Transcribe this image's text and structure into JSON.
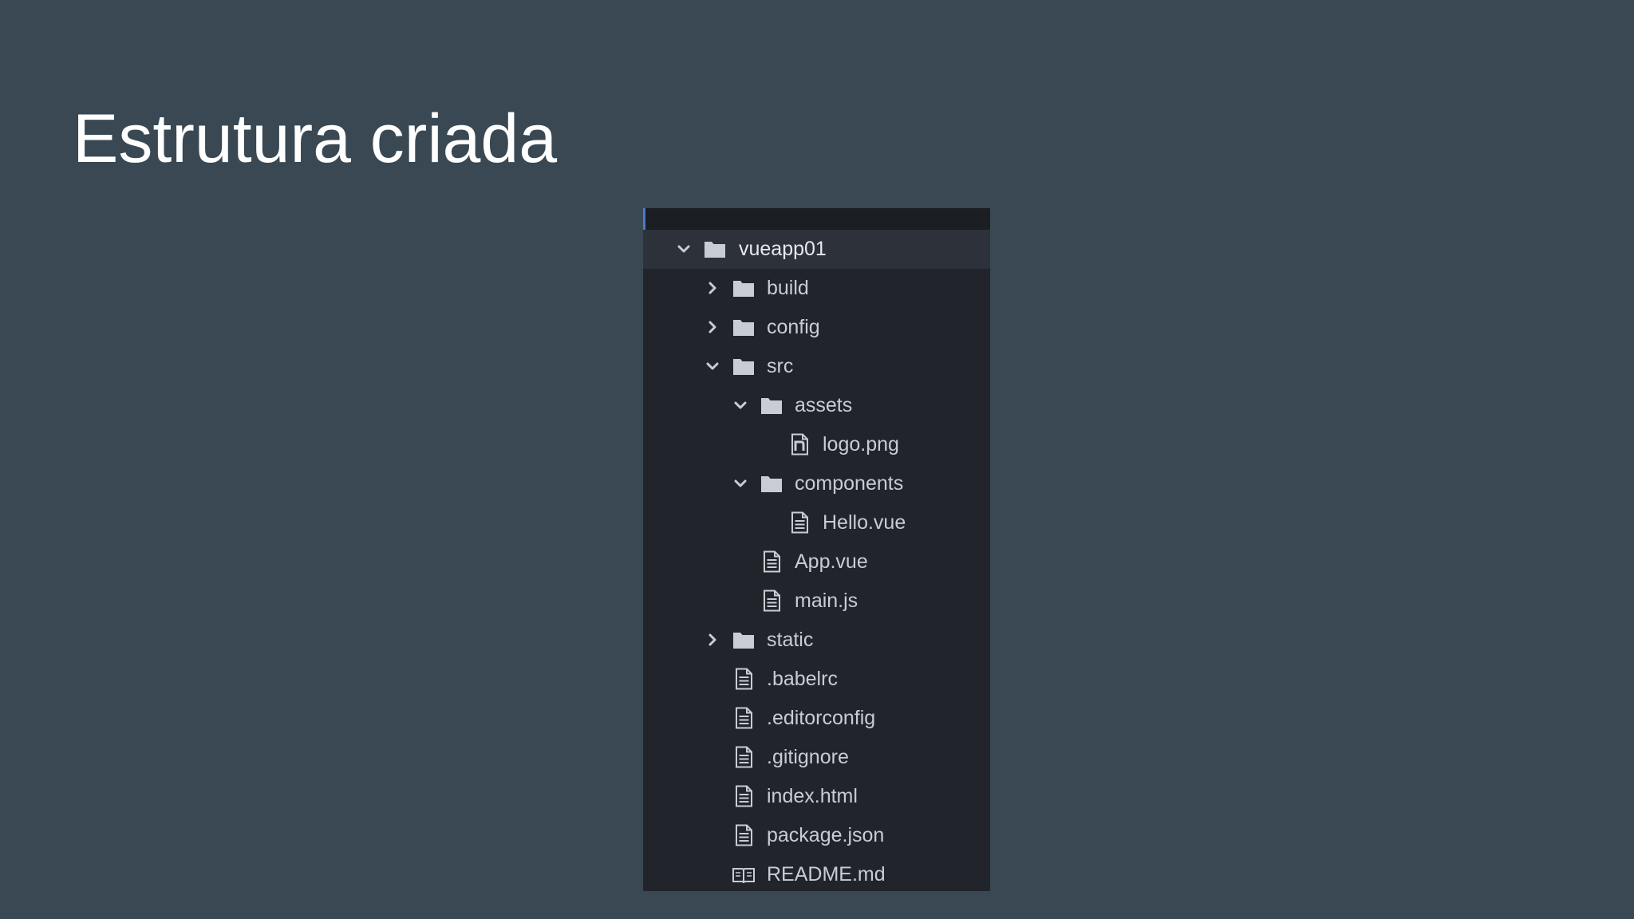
{
  "slide": {
    "title": "Estrutura criada"
  },
  "colors": {
    "background": "#394852",
    "panel": "#21252b",
    "selected_row": "#2c313a",
    "text": "#c8cdd4",
    "icon": "#c8cdd4"
  },
  "tree": {
    "root": {
      "label": "vueapp01",
      "icon": "folder-icon",
      "state": "expanded"
    },
    "build": {
      "label": "build",
      "icon": "folder-icon",
      "state": "collapsed"
    },
    "config": {
      "label": "config",
      "icon": "folder-icon",
      "state": "collapsed"
    },
    "src": {
      "label": "src",
      "icon": "folder-icon",
      "state": "expanded"
    },
    "assets": {
      "label": "assets",
      "icon": "folder-icon",
      "state": "expanded"
    },
    "logo_png": {
      "label": "logo.png",
      "icon": "image-file-icon"
    },
    "components": {
      "label": "components",
      "icon": "folder-icon",
      "state": "expanded"
    },
    "hello_vue": {
      "label": "Hello.vue",
      "icon": "file-icon"
    },
    "app_vue": {
      "label": "App.vue",
      "icon": "file-icon"
    },
    "main_js": {
      "label": "main.js",
      "icon": "file-icon"
    },
    "static": {
      "label": "static",
      "icon": "folder-icon",
      "state": "collapsed"
    },
    "babelrc": {
      "label": ".babelrc",
      "icon": "file-icon"
    },
    "editorconfig": {
      "label": ".editorconfig",
      "icon": "file-icon"
    },
    "gitignore": {
      "label": ".gitignore",
      "icon": "file-icon"
    },
    "index_html": {
      "label": "index.html",
      "icon": "file-icon"
    },
    "package_json": {
      "label": "package.json",
      "icon": "file-icon"
    },
    "readme_md": {
      "label": "README.md",
      "icon": "book-icon"
    }
  }
}
